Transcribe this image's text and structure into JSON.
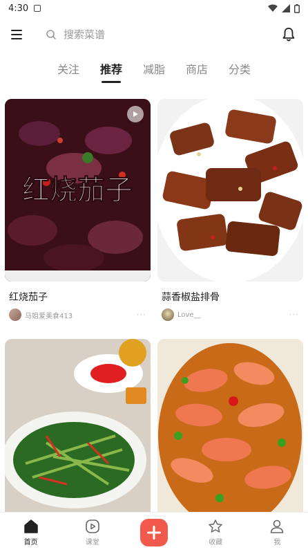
{
  "status_bar": {
    "time": "4:30"
  },
  "search": {
    "placeholder": "搜索菜谱"
  },
  "tabs": [
    {
      "label": "关注",
      "active": false
    },
    {
      "label": "推荐",
      "active": true
    },
    {
      "label": "减脂",
      "active": false
    },
    {
      "label": "商店",
      "active": false
    },
    {
      "label": "分类",
      "active": false
    }
  ],
  "feed": [
    {
      "title": "红烧茄子",
      "author": "马姐爱美食413",
      "image_text": "红烧茄子",
      "has_video": true
    },
    {
      "title": "蒜香椒盐排骨",
      "author": "Love__",
      "has_video": false
    },
    {
      "title": "",
      "author": "",
      "has_video": false
    },
    {
      "title": "",
      "author": "",
      "has_video": false
    }
  ],
  "card_more": "···",
  "bottom_nav": [
    {
      "label": "首页",
      "icon": "home-icon",
      "active": true
    },
    {
      "label": "课堂",
      "icon": "play-square-icon",
      "active": false
    },
    {
      "label": "",
      "icon": "plus-icon",
      "active": false
    },
    {
      "label": "收藏",
      "icon": "star-icon",
      "active": false
    },
    {
      "label": "我",
      "icon": "person-icon",
      "active": false
    }
  ],
  "colors": {
    "accent": "#f15a4b",
    "text": "#222222",
    "muted": "#999999"
  }
}
